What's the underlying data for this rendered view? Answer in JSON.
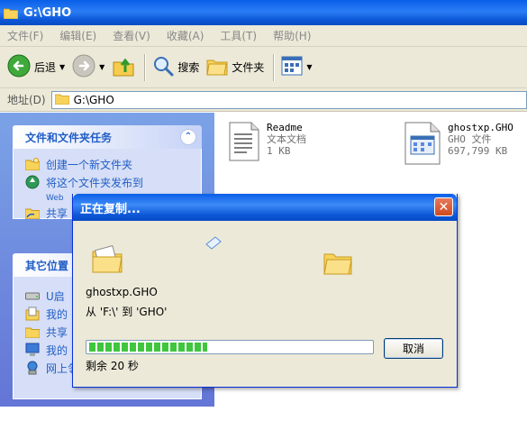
{
  "window": {
    "title": "G:\\GHO"
  },
  "menu": [
    "文件(F)",
    "编辑(E)",
    "查看(V)",
    "收藏(A)",
    "工具(T)",
    "帮助(H)"
  ],
  "toolbar": {
    "back_label": "后退",
    "search_label": "搜索",
    "folders_label": "文件夹"
  },
  "address": {
    "label": "地址(D)",
    "value": "G:\\GHO"
  },
  "tasks_panel": {
    "title": "文件和文件夹任务",
    "items": [
      {
        "label": "创建一个新文件夹",
        "icon": "new-folder-icon"
      },
      {
        "label": "将这个文件夹发布到",
        "sub": "Web",
        "icon": "publish-web-icon"
      },
      {
        "label": "共享",
        "icon": "share-folder-icon"
      }
    ]
  },
  "places_panel": {
    "title": "其它位置",
    "items": [
      {
        "label": "U启",
        "icon": "drive-icon"
      },
      {
        "label": "我的",
        "icon": "my-documents-icon"
      },
      {
        "label": "共享",
        "icon": "shared-folder-icon"
      },
      {
        "label": "我的",
        "icon": "my-computer-icon"
      },
      {
        "label": "网上邻居",
        "icon": "network-icon"
      }
    ]
  },
  "files": [
    {
      "name": "Readme",
      "type": "文本文档",
      "size": "1 KB",
      "icon": "text-document-icon"
    },
    {
      "name": "ghostxp.GHO",
      "type": "GHO 文件",
      "size": "697,799 KB",
      "icon": "gho-file-icon"
    }
  ],
  "dialog": {
    "title": "正在复制...",
    "filename": "ghostxp.GHO",
    "from_to": "从 'F:\\' 到 'GHO'",
    "remaining": "剩余 20 秒",
    "progress": 0.42,
    "cancel_label": "取消"
  },
  "colors": {
    "titlebar": "#0a5fe8",
    "taskpane": "#7ba2e7",
    "link": "#215dc6",
    "progress": "#3fc63c"
  }
}
